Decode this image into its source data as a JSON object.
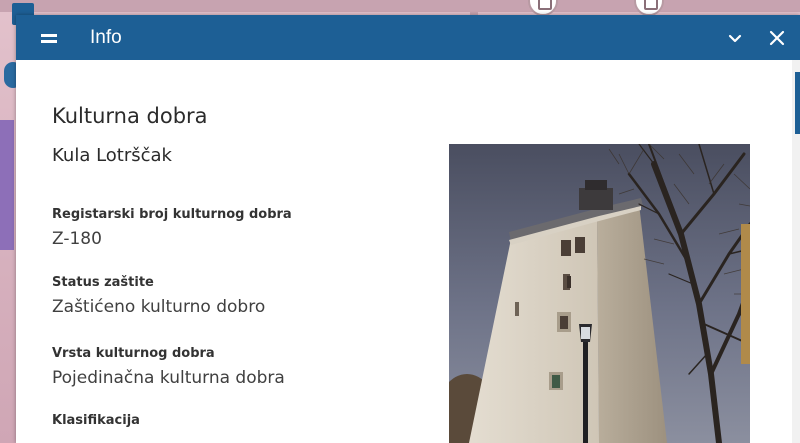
{
  "window": {
    "title": "Info",
    "menu_icon": "hamburger-icon",
    "collapse_icon": "chevron-down-icon",
    "close_icon": "close-icon"
  },
  "section": {
    "title": "Kulturna dobra",
    "object_name": "Kula Lotrščak"
  },
  "fields": [
    {
      "label": "Registarski broj kulturnog dobra",
      "value": "Z-180"
    },
    {
      "label": "Status zaštite",
      "value": "Zaštićeno kulturno dobro"
    },
    {
      "label": "Vrsta kulturnog dobra",
      "value": "Pojedinačna kulturna dobra"
    },
    {
      "label": "Klasifikacija",
      "value": ""
    }
  ],
  "colors": {
    "header": "#1d5f95",
    "map_background": "#d9b8c4"
  },
  "photo": {
    "subject": "photo of a white stone tower with a street lamp and bare tree"
  }
}
